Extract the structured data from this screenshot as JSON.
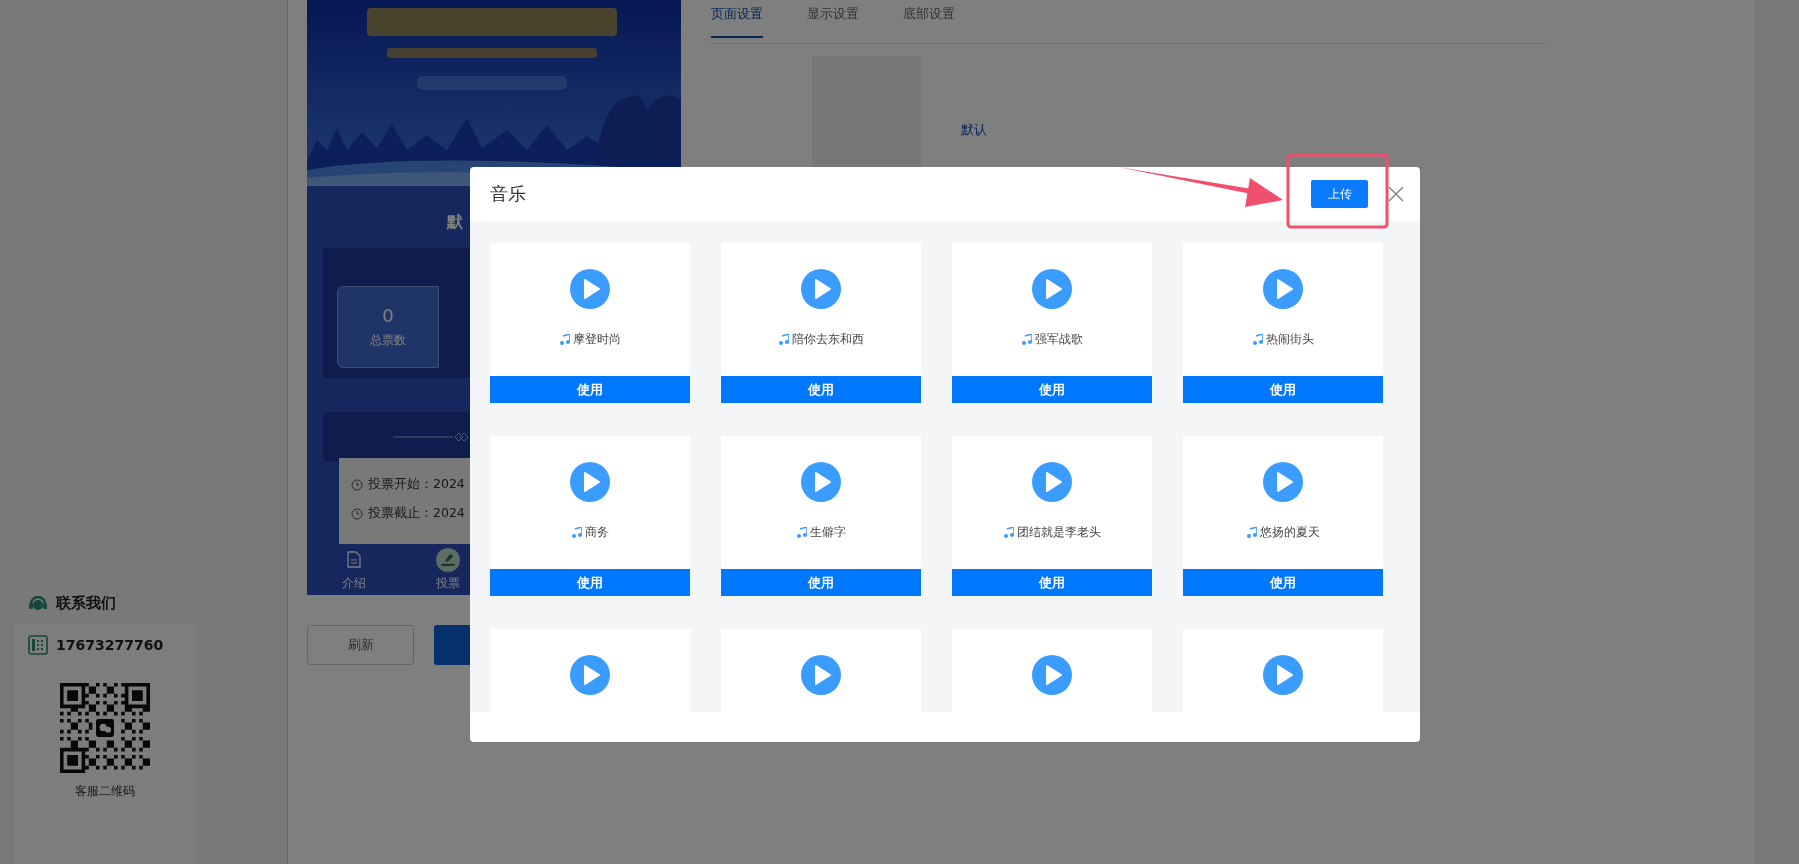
{
  "contact": {
    "title": "联系我们",
    "phone": "17673277760",
    "qr_caption": "客服二维码"
  },
  "preview": {
    "heading": "默",
    "stats": [
      {
        "value": "0",
        "label": "总票数"
      }
    ],
    "info_lines": [
      "投票开始：2024",
      "投票截止：2024"
    ],
    "nav": [
      {
        "label": "介绍",
        "kind": "doc",
        "selected": false
      },
      {
        "label": "投票",
        "kind": "vote",
        "selected": true
      }
    ],
    "buttons": [
      {
        "label": "刷新",
        "kind": "outline"
      },
      {
        "kind": "primary"
      }
    ]
  },
  "settings": {
    "tabs": [
      {
        "label": "页面设置",
        "selected": true
      },
      {
        "label": "显示设置",
        "selected": false
      },
      {
        "label": "底部设置",
        "selected": false
      }
    ],
    "default_link": "默认"
  },
  "dialog": {
    "title": "音乐",
    "upload": "上传",
    "tracks": [
      {
        "kind": "full",
        "name": "摩登时尚",
        "action": "使用"
      },
      {
        "kind": "full",
        "name": "陪你去东和西",
        "action": "使用"
      },
      {
        "kind": "full",
        "name": "强军战歌",
        "action": "使用"
      },
      {
        "kind": "full",
        "name": "热闹街头",
        "action": "使用"
      },
      {
        "kind": "full",
        "name": "商务",
        "action": "使用"
      },
      {
        "kind": "full",
        "name": "生僻字",
        "action": "使用"
      },
      {
        "kind": "full",
        "name": "团结就是李老头",
        "action": "使用"
      },
      {
        "kind": "full",
        "name": "悠扬的夏天",
        "action": "使用"
      },
      {
        "kind": "partial"
      },
      {
        "kind": "partial"
      },
      {
        "kind": "partial"
      },
      {
        "kind": "partial"
      }
    ]
  }
}
